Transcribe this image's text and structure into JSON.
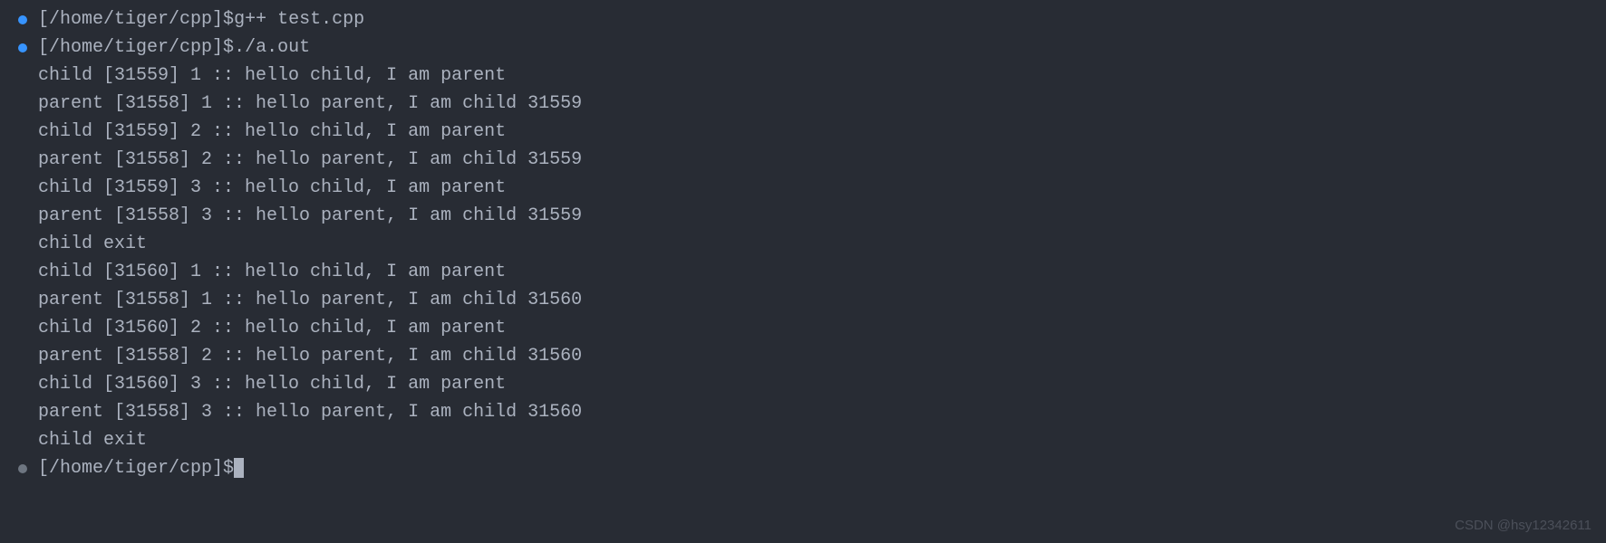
{
  "terminal": {
    "prompt_path": "[/home/tiger/cpp]",
    "prompt_symbol": "$",
    "lines": [
      {
        "type": "command",
        "marker": "blue",
        "text": "g++ test.cpp"
      },
      {
        "type": "command",
        "marker": "blue",
        "text": "./a.out"
      },
      {
        "type": "output",
        "marker": "",
        "text": "child [31559] 1 :: hello child, I am parent"
      },
      {
        "type": "output",
        "marker": "",
        "text": "parent [31558] 1 :: hello parent, I am child 31559"
      },
      {
        "type": "output",
        "marker": "",
        "text": "child [31559] 2 :: hello child, I am parent"
      },
      {
        "type": "output",
        "marker": "",
        "text": "parent [31558] 2 :: hello parent, I am child 31559"
      },
      {
        "type": "output",
        "marker": "",
        "text": "child [31559] 3 :: hello child, I am parent"
      },
      {
        "type": "output",
        "marker": "",
        "text": "parent [31558] 3 :: hello parent, I am child 31559"
      },
      {
        "type": "output",
        "marker": "",
        "text": "child exit"
      },
      {
        "type": "output",
        "marker": "",
        "text": "child [31560] 1 :: hello child, I am parent"
      },
      {
        "type": "output",
        "marker": "",
        "text": "parent [31558] 1 :: hello parent, I am child 31560"
      },
      {
        "type": "output",
        "marker": "",
        "text": "child [31560] 2 :: hello child, I am parent"
      },
      {
        "type": "output",
        "marker": "",
        "text": "parent [31558] 2 :: hello parent, I am child 31560"
      },
      {
        "type": "output",
        "marker": "",
        "text": "child [31560] 3 :: hello child, I am parent"
      },
      {
        "type": "output",
        "marker": "",
        "text": "parent [31558] 3 :: hello parent, I am child 31560"
      },
      {
        "type": "output",
        "marker": "",
        "text": "child exit"
      },
      {
        "type": "prompt",
        "marker": "gray",
        "text": ""
      }
    ]
  },
  "watermark": "CSDN @hsy12342611"
}
